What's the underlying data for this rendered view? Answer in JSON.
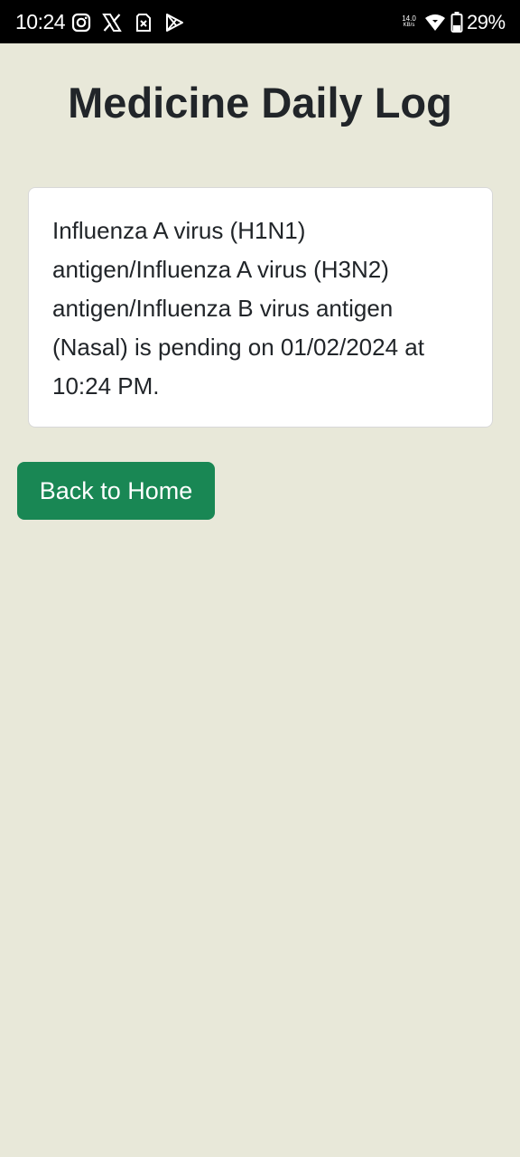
{
  "status_bar": {
    "time": "10:24",
    "net_speed_value": "14.0",
    "net_speed_unit": "KB/s",
    "battery_percent": "29%",
    "icons": [
      "instagram-icon",
      "x-icon",
      "sim-icon",
      "play-store-icon",
      "wifi-icon",
      "battery-icon"
    ]
  },
  "page": {
    "title": "Medicine Daily Log",
    "message": "Influenza A virus (H1N1) antigen/Influenza A virus (H3N2) antigen/Influenza B virus antigen (Nasal) is pending on 01/02/2024 at 10:24 PM.",
    "back_button_label": "Back to Home"
  },
  "colors": {
    "background": "#e8e8d9",
    "status_bar": "#000000",
    "card": "#ffffff",
    "button": "#198754",
    "button_text": "#ffffff",
    "text": "#212529"
  }
}
